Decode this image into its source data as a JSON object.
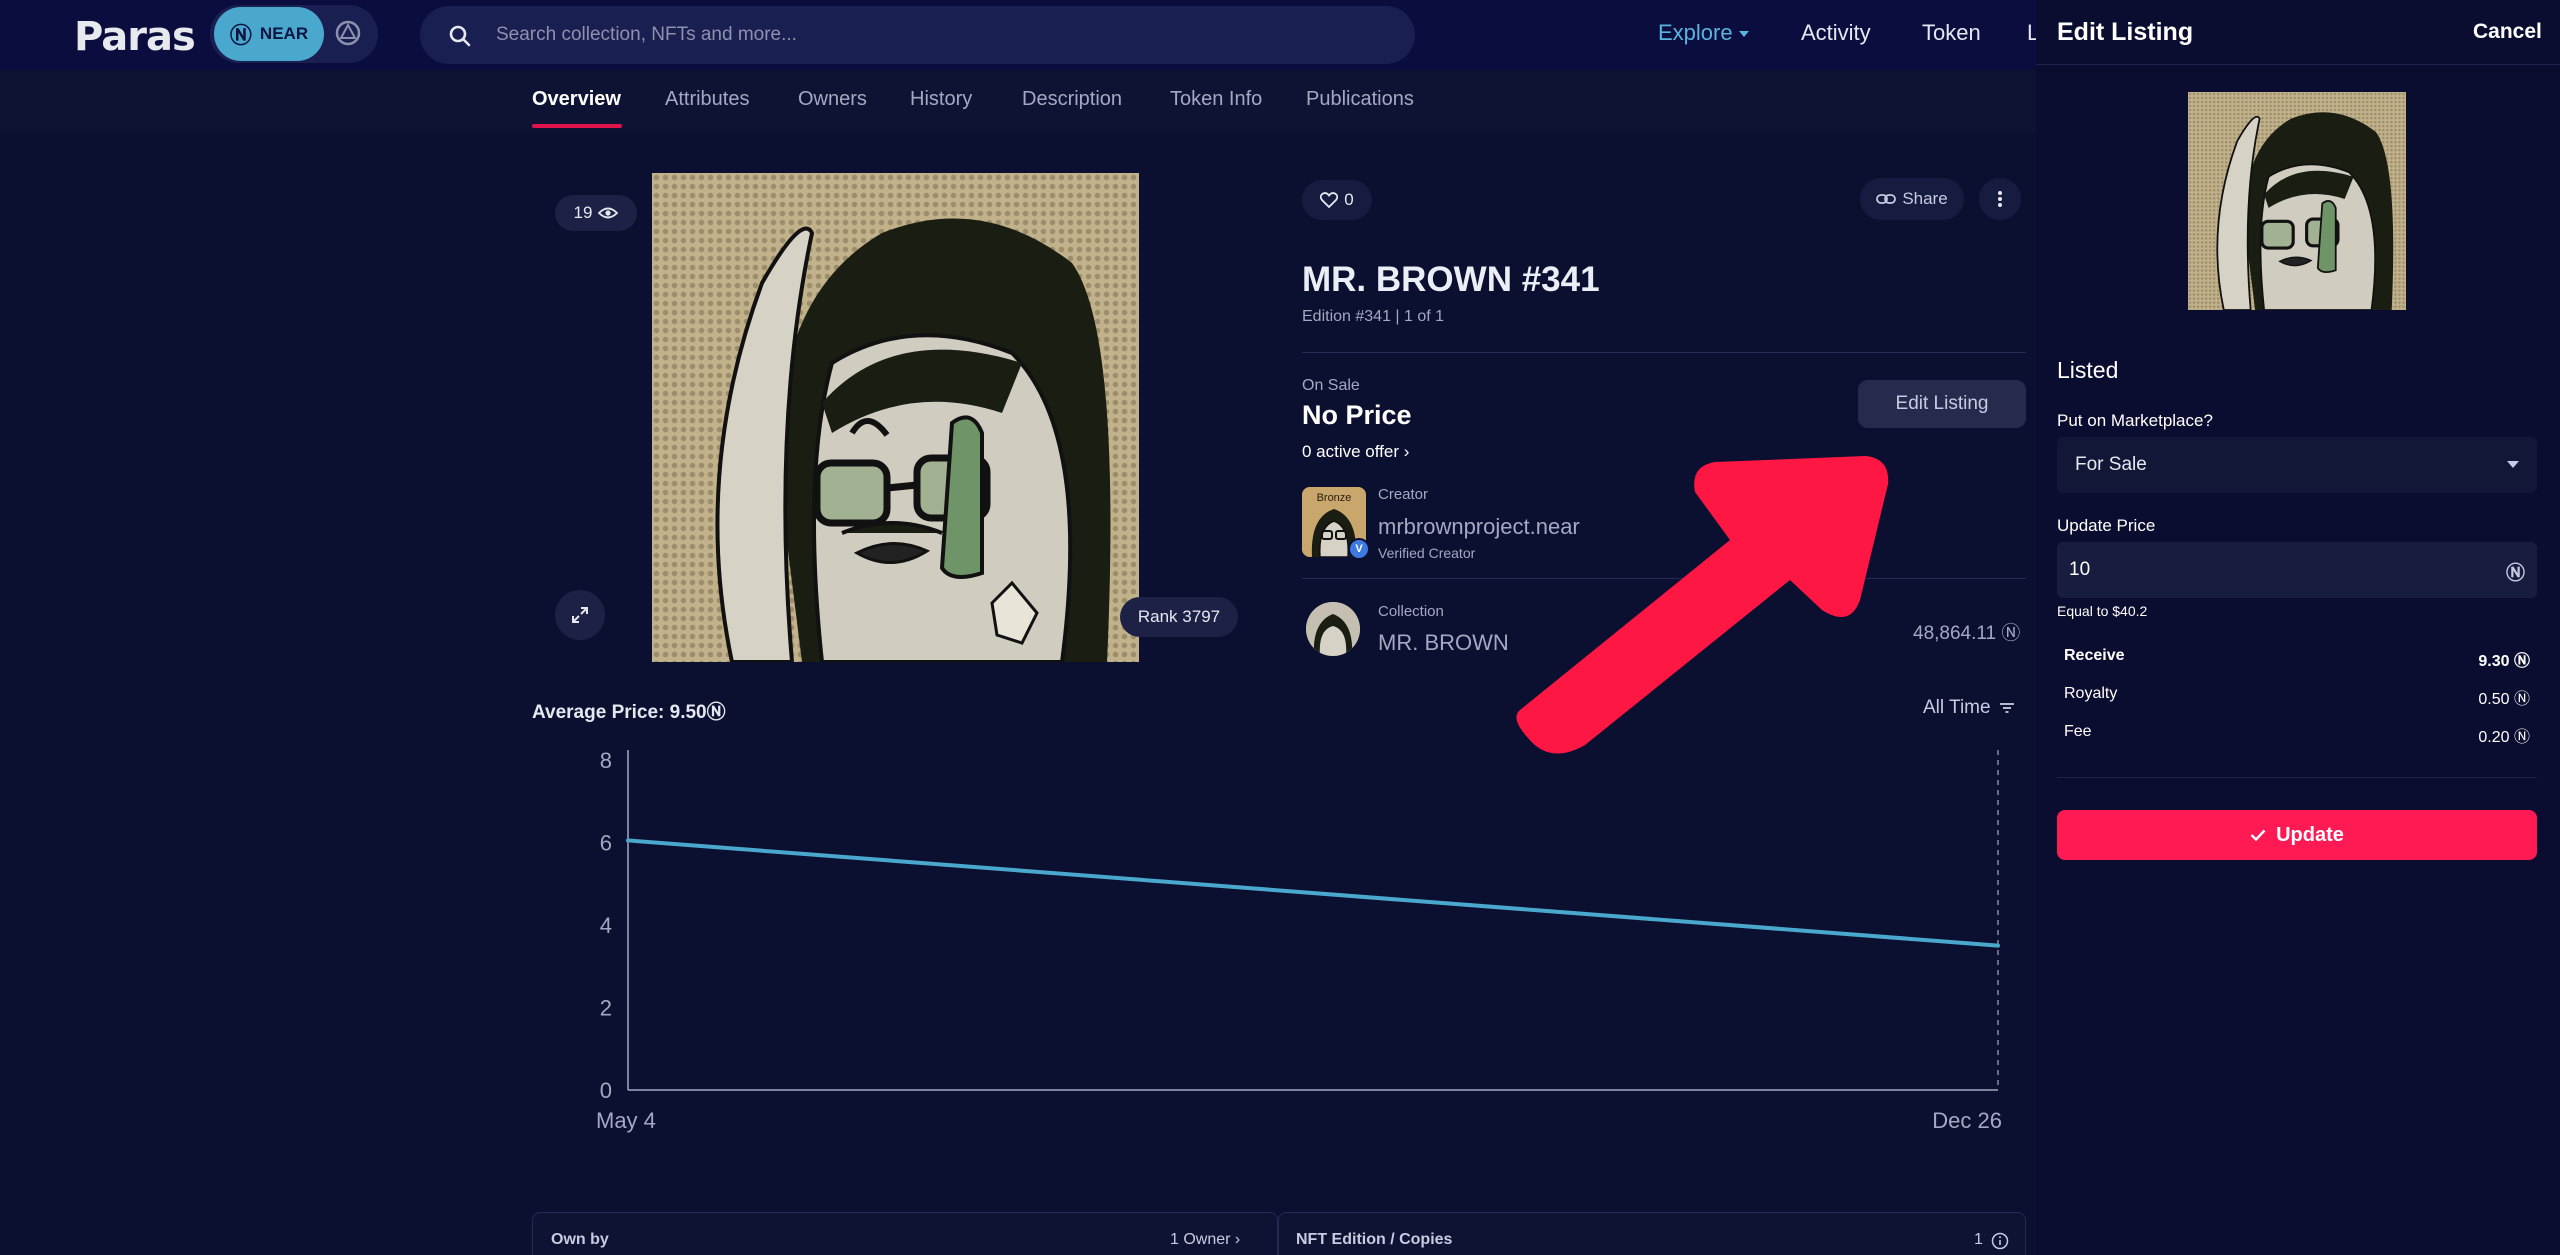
{
  "brand": {
    "logo": "Paras",
    "network": "NEAR",
    "network_symbol": "Ⓝ",
    "network_color": "#4aa8cf",
    "accent": "#e0134d",
    "button_color": "#ff1a54"
  },
  "search": {
    "placeholder": "Search collection, NFTs and more..."
  },
  "nav": {
    "explore": "Explore",
    "activity": "Activity",
    "token": "Token",
    "more": "L"
  },
  "tabs": [
    {
      "label": "Overview",
      "active": true
    },
    {
      "label": "Attributes"
    },
    {
      "label": "Owners"
    },
    {
      "label": "History"
    },
    {
      "label": "Description"
    },
    {
      "label": "Token Info"
    },
    {
      "label": "Publications"
    }
  ],
  "artwork": {
    "views": "19",
    "rank": "Rank 3797"
  },
  "token": {
    "likes": "0",
    "share": "Share",
    "title": "MR. BROWN #341",
    "edition": "Edition #341 | 1 of 1",
    "on_sale_label": "On Sale",
    "price": "No Price",
    "offers": "0 active offer",
    "edit_listing": "Edit Listing"
  },
  "creator": {
    "label": "Creator",
    "name": "mrbrownproject.near",
    "verified": "Verified Creator",
    "tier": "Bronze"
  },
  "collection": {
    "label": "Collection",
    "name": "MR. BROWN",
    "volume": "48,864.11 Ⓝ"
  },
  "chart_header": {
    "average": "Average Price: 9.50Ⓝ",
    "range": "All Time"
  },
  "chart_data": {
    "type": "line",
    "x": [
      "May 4",
      "Dec 26"
    ],
    "series": [
      {
        "values": [
          6.05,
          3.5
        ],
        "color": "#4aa8cf"
      }
    ],
    "yticks": [
      0,
      2,
      4,
      6,
      8
    ],
    "ylim": [
      0,
      8
    ],
    "xlabel": "",
    "ylabel": "",
    "grid": false
  },
  "bottom": {
    "own_by": "Own by",
    "owners": "1 Owner",
    "copies_label": "NFT Edition / Copies",
    "copies": "1"
  },
  "panel": {
    "title": "Edit Listing",
    "cancel": "Cancel",
    "status": "Listed",
    "marketplace_label": "Put on Marketplace?",
    "marketplace_value": "For Sale",
    "price_label": "Update Price",
    "price_value": "10",
    "price_symbol": "Ⓝ",
    "equal": "Equal to $40.2",
    "rows": [
      {
        "label": "Receive",
        "value": "9.30 Ⓝ"
      },
      {
        "label": "Royalty",
        "value": "0.50 Ⓝ"
      },
      {
        "label": "Fee",
        "value": "0.20 Ⓝ"
      }
    ],
    "update": "Update"
  },
  "icons": {
    "search": "search-icon",
    "eye": "eye-icon",
    "expand": "expand-icon",
    "heart": "heart-icon",
    "link": "link-icon",
    "more": "more-vertical-icon",
    "chevron": "chevron-right-icon",
    "filter": "filter-icon",
    "info": "info-icon",
    "check": "check-icon",
    "arrow": "red-arrow-annotation"
  }
}
